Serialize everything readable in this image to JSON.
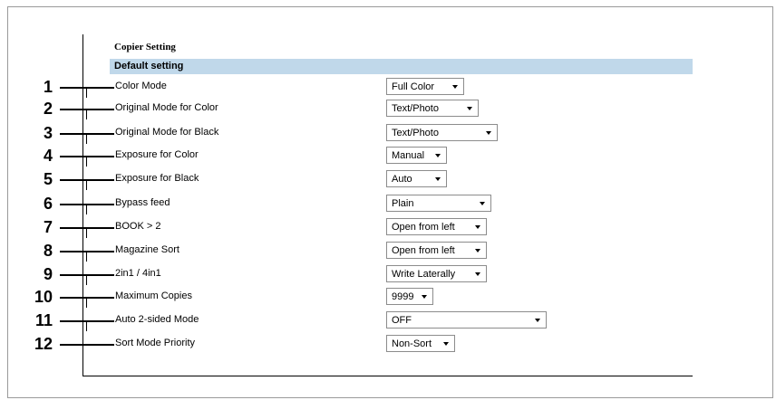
{
  "section": {
    "title": "Copier Setting",
    "subtitle": "Default setting"
  },
  "rows": [
    {
      "number": "1",
      "label": "Color Mode",
      "value": "Full Color"
    },
    {
      "number": "2",
      "label": "Original Mode for Color",
      "value": "Text/Photo"
    },
    {
      "number": "3",
      "label": "Original Mode for Black",
      "value": "Text/Photo"
    },
    {
      "number": "4",
      "label": "Exposure for Color",
      "value": "Manual"
    },
    {
      "number": "5",
      "label": "Exposure for Black",
      "value": "Auto"
    },
    {
      "number": "6",
      "label": "Bypass feed",
      "value": "Plain"
    },
    {
      "number": "7",
      "label": "BOOK > 2",
      "value": "Open from left"
    },
    {
      "number": "8",
      "label": "Magazine Sort",
      "value": "Open from left"
    },
    {
      "number": "9",
      "label": "2in1 / 4in1",
      "value": "Write Laterally"
    },
    {
      "number": "10",
      "label": "Maximum Copies",
      "value": "9999"
    },
    {
      "number": "11",
      "label": "Auto 2-sided Mode",
      "value": "OFF"
    },
    {
      "number": "12",
      "label": "Sort Mode Priority",
      "value": "Non-Sort"
    }
  ]
}
